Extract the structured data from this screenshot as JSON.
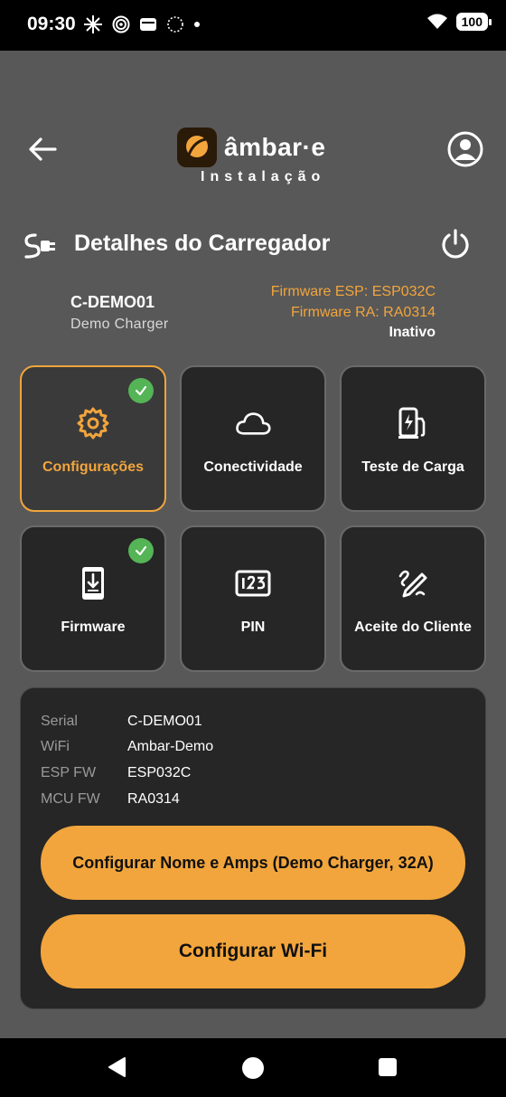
{
  "status_bar": {
    "time": "09:30",
    "battery": "100"
  },
  "header": {
    "logo_text": "âmbar·e",
    "subtitle": "Instalação"
  },
  "page": {
    "title": "Detalhes do Carregador"
  },
  "charger": {
    "id": "C-DEMO01",
    "name": "Demo Charger",
    "firmware_esp": "Firmware ESP: ESP032C",
    "firmware_ra": "Firmware RA: RA0314",
    "status": "Inativo"
  },
  "tiles": [
    {
      "label": "Configurações",
      "icon": "gear-icon",
      "active": true,
      "done": true
    },
    {
      "label": "Conectividade",
      "icon": "cloud-icon",
      "active": false,
      "done": false
    },
    {
      "label": "Teste de Carga",
      "icon": "charging-station-icon",
      "active": false,
      "done": false
    },
    {
      "label": "Firmware",
      "icon": "phone-download-icon",
      "active": false,
      "done": true
    },
    {
      "label": "PIN",
      "icon": "pin-123-icon",
      "active": false,
      "done": false
    },
    {
      "label": "Aceite do Cliente",
      "icon": "signature-pen-icon",
      "active": false,
      "done": false
    }
  ],
  "details": {
    "rows": [
      {
        "key": "Serial",
        "value": "C-DEMO01"
      },
      {
        "key": "WiFi",
        "value": "Ambar-Demo"
      },
      {
        "key": "ESP FW",
        "value": "ESP032C"
      },
      {
        "key": "MCU FW",
        "value": "RA0314"
      }
    ],
    "configure_name_button": "Configurar Nome e Amps (Demo Charger, 32A)",
    "configure_wifi_button": "Configurar Wi-Fi"
  },
  "colors": {
    "accent": "#f2a53c",
    "background": "#585858",
    "card": "#262626",
    "success": "#55b456"
  }
}
